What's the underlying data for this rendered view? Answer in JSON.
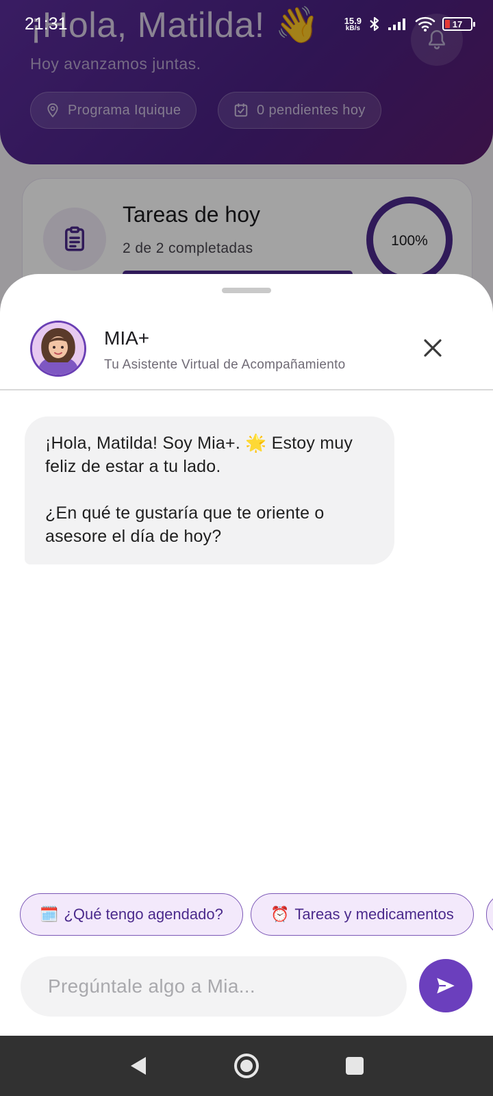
{
  "status_bar": {
    "time": "21:31",
    "net_speed_value": "15.9",
    "net_speed_unit": "kB/s",
    "battery_level": "17",
    "icons": [
      "bluetooth-icon",
      "signal-icon",
      "wifi-icon",
      "battery-icon"
    ]
  },
  "header": {
    "greeting": "¡Hola, Matilda!",
    "greeting_emoji": "👋",
    "subtitle": "Hoy avanzamos juntas.",
    "chips": [
      {
        "icon": "location-pin-icon",
        "label": "Programa Iquique"
      },
      {
        "icon": "checkbox-calendar-icon",
        "label": "0 pendientes hoy"
      }
    ]
  },
  "tasks_card": {
    "title": "Tareas de hoy",
    "subtitle": "2 de 2 completadas",
    "progress_label": "100%",
    "progress_value": 1.0
  },
  "chat_sheet": {
    "bot_name": "MIA+",
    "bot_subtitle": "Tu Asistente Virtual de Acompañamiento",
    "messages": [
      {
        "sender": "bot",
        "paragraphs": [
          "¡Hola, Matilda! Soy Mia+. 🌟 Estoy muy feliz de estar a tu lado.",
          "¿En qué te gustaría que te oriente o asesore el día de hoy?"
        ]
      }
    ],
    "quick_replies": [
      {
        "emoji": "🗓️",
        "label": "¿Qué tengo agendado?"
      },
      {
        "emoji": "⏰",
        "label": "Tareas y medicamentos"
      }
    ],
    "input_placeholder": "Pregúntale algo a Mia..."
  },
  "colors": {
    "brand_purple": "#6b3fbd",
    "header_gradient_start": "#5a2d9a",
    "header_gradient_end": "#5a1c6e",
    "chip_bg": "#f3e9fb",
    "bubble_bg": "#f2f2f3",
    "nav_bar": "#313131"
  }
}
